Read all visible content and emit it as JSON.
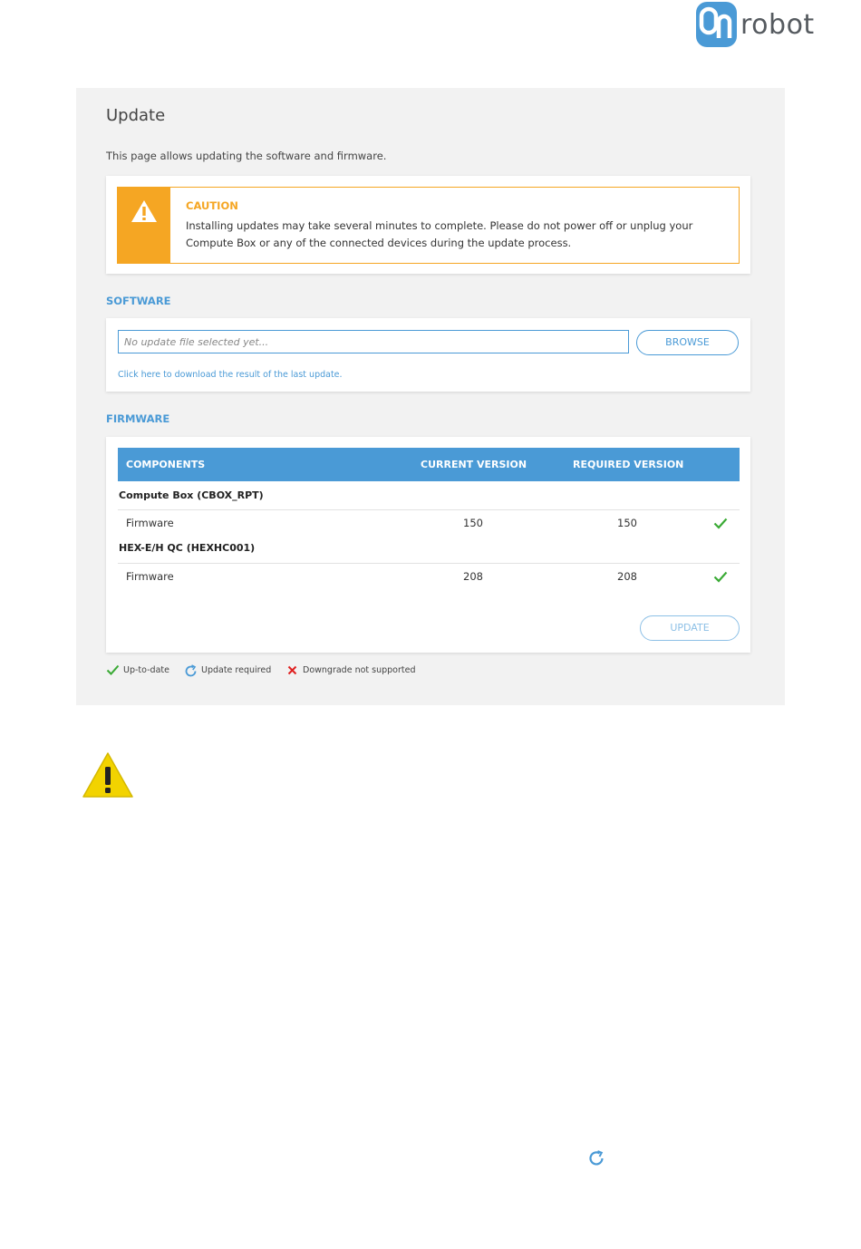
{
  "brand": {
    "logo_text": "robot",
    "logo_badge_text": "On",
    "badge_color": "#4a9ad6"
  },
  "page": {
    "title": "Update",
    "description": "This page allows updating the software and firmware."
  },
  "caution": {
    "title": "CAUTION",
    "text": "Installing updates may take several minutes to complete. Please do not power off or unplug your Compute Box or any of the connected devices during the update process.",
    "color": "#f5a623",
    "icon": "warning-icon"
  },
  "software": {
    "section_label": "SOFTWARE",
    "file_placeholder": "No update file selected yet...",
    "browse_label": "BROWSE",
    "download_link": "Click here to download the result of the last update."
  },
  "firmware": {
    "section_label": "FIRMWARE",
    "columns": [
      "COMPONENTS",
      "CURRENT VERSION",
      "REQUIRED VERSION"
    ],
    "groups": [
      {
        "name": "Compute Box (CBOX_RPT)",
        "rows": [
          {
            "component": "Firmware",
            "current": "150",
            "required": "150",
            "status": "up-to-date"
          }
        ]
      },
      {
        "name": "HEX-E/H QC (HEXHC001)",
        "rows": [
          {
            "component": "Firmware",
            "current": "208",
            "required": "208",
            "status": "up-to-date"
          }
        ]
      }
    ],
    "update_label": "UPDATE"
  },
  "legend": {
    "up_to_date": "Up-to-date",
    "update_required": "Update required",
    "downgrade_not_supported": "Downgrade not supported"
  },
  "colors": {
    "accent": "#4a9ad6",
    "success": "#3aaa35",
    "error": "#e02020",
    "warning_yellow": "#f2d300"
  }
}
